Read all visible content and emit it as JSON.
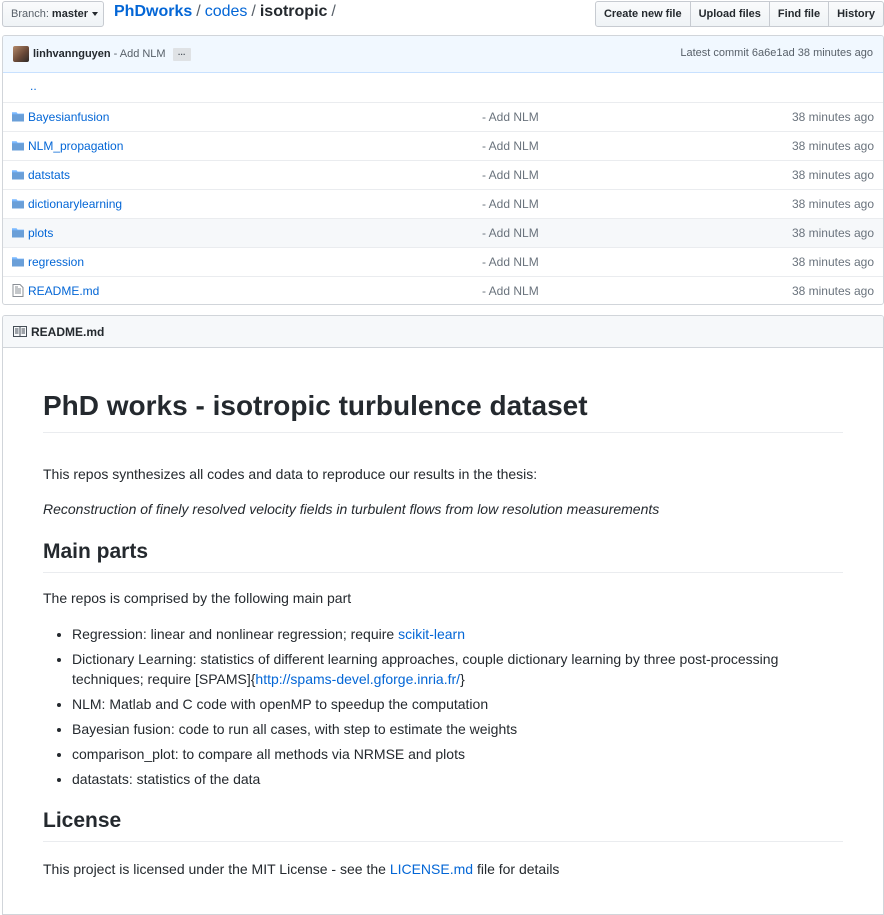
{
  "toolbar": {
    "branch_label": "Branch:",
    "branch_name": "master",
    "repo": "PhDworks",
    "dir": "codes",
    "current": "isotropic",
    "sep1": "/",
    "sep2": "/",
    "sep3": "/",
    "create_file": "Create new file",
    "upload_files": "Upload files",
    "find_file": "Find file",
    "history": "History"
  },
  "commit": {
    "user": "linhvannguyen",
    "message": "- Add NLM",
    "ellipsis": "…",
    "latest_label": "Latest commit",
    "sha": "6a6e1ad",
    "age": "38 minutes ago"
  },
  "files": {
    "updir": "..",
    "rows": [
      {
        "name": "Bayesianfusion",
        "type": "folder",
        "message": "- Add NLM",
        "age": "38 minutes ago"
      },
      {
        "name": "NLM_propagation",
        "type": "folder",
        "message": "- Add NLM",
        "age": "38 minutes ago"
      },
      {
        "name": "datstats",
        "type": "folder",
        "message": "- Add NLM",
        "age": "38 minutes ago"
      },
      {
        "name": "dictionarylearning",
        "type": "folder",
        "message": "- Add NLM",
        "age": "38 minutes ago"
      },
      {
        "name": "plots",
        "type": "folder",
        "message": "- Add NLM",
        "age": "38 minutes ago"
      },
      {
        "name": "regression",
        "type": "folder",
        "message": "- Add NLM",
        "age": "38 minutes ago"
      },
      {
        "name": "README.md",
        "type": "file",
        "message": "- Add NLM",
        "age": "38 minutes ago"
      }
    ]
  },
  "readme": {
    "header": "README.md",
    "title": "PhD works - isotropic turbulence dataset",
    "intro": "This repos synthesizes all codes and data to reproduce our results in the thesis:",
    "thesis": "Reconstruction of finely resolved velocity fields in turbulent flows from low resolution measurements",
    "main_parts_heading": "Main parts",
    "main_parts_intro": "The repos is comprised by the following main part",
    "items": {
      "i1_text": "Regression: linear and nonlinear regression; require ",
      "i1_link": "scikit-learn",
      "i2_text": "Dictionary Learning: statistics of different learning approaches, couple dictionary learning by three post-processing techniques; require [SPAMS]{",
      "i2_link": "http://spams-devel.gforge.inria.fr/",
      "i2_end": "}",
      "i3": "NLM: Matlab and C code with openMP to speedup the computation",
      "i4": "Bayesian fusion: code to run all cases, with step to estimate the weights",
      "i5": "comparison_plot: to compare all methods via NRMSE and plots",
      "i6": "datastats: statistics of the data"
    },
    "license_heading": "License",
    "license_text": "This project is licensed under the MIT License - see the ",
    "license_link": "LICENSE.md",
    "license_end": " file for details"
  }
}
